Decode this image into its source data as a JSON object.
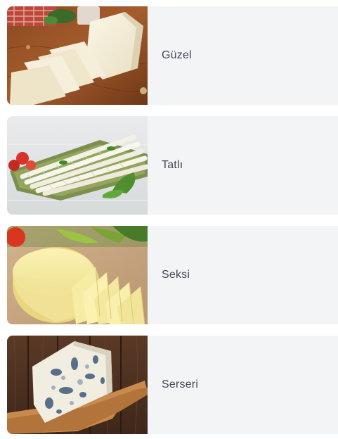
{
  "items": [
    {
      "label": "Güzel",
      "image": "white-cheese-block-photo"
    },
    {
      "label": "Tatlı",
      "image": "string-cheese-platter-photo"
    },
    {
      "label": "Seksi",
      "image": "kashar-cheese-wheel-photo"
    },
    {
      "label": "Serseri",
      "image": "blue-cheese-board-photo"
    }
  ]
}
